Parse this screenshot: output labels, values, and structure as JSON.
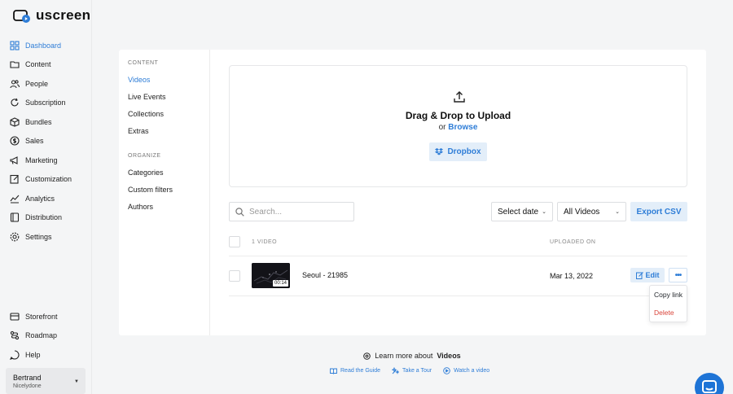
{
  "brand": {
    "name": "uscreen",
    "accent": "#2e7dd7"
  },
  "sidebar": {
    "items": [
      {
        "label": "Dashboard",
        "icon": "dashboard-icon"
      },
      {
        "label": "Content",
        "icon": "folder-icon"
      },
      {
        "label": "People",
        "icon": "people-icon"
      },
      {
        "label": "Subscription",
        "icon": "subscription-icon"
      },
      {
        "label": "Bundles",
        "icon": "box-icon"
      },
      {
        "label": "Sales",
        "icon": "dollar-icon"
      },
      {
        "label": "Marketing",
        "icon": "megaphone-icon"
      },
      {
        "label": "Customization",
        "icon": "edit-icon"
      },
      {
        "label": "Analytics",
        "icon": "analytics-icon"
      },
      {
        "label": "Distribution",
        "icon": "device-icon"
      },
      {
        "label": "Settings",
        "icon": "gear-icon"
      }
    ],
    "bottom_items": [
      {
        "label": "Storefront",
        "icon": "storefront-icon"
      },
      {
        "label": "Roadmap",
        "icon": "roadmap-icon"
      },
      {
        "label": "Help",
        "icon": "help-icon"
      }
    ],
    "user": {
      "name": "Bertrand",
      "org": "Nicelydone"
    }
  },
  "subnav": {
    "content_heading": "CONTENT",
    "content_items": [
      "Videos",
      "Live Events",
      "Collections",
      "Extras"
    ],
    "organize_heading": "ORGANIZE",
    "organize_items": [
      "Categories",
      "Custom filters",
      "Authors"
    ]
  },
  "upload": {
    "title": "Drag & Drop to Upload",
    "or": "or",
    "browse": "Browse",
    "dropbox": "Dropbox"
  },
  "toolbar": {
    "search_placeholder": "Search...",
    "date_select": "Select date",
    "videos_select": "All Videos",
    "export": "Export CSV"
  },
  "table": {
    "count_header": "1 VIDEO",
    "date_header": "UPLOADED ON",
    "rows": [
      {
        "title": "Seoul - 21985",
        "duration": "00:14",
        "uploaded": "Mar 13, 2022",
        "edit": "Edit"
      }
    ]
  },
  "row_menu": {
    "copy": "Copy link",
    "delete": "Delete"
  },
  "footer": {
    "learn_prefix": "Learn more about",
    "learn_topic": "Videos",
    "links": [
      "Read the Guide",
      "Take a Tour",
      "Watch a video"
    ]
  }
}
